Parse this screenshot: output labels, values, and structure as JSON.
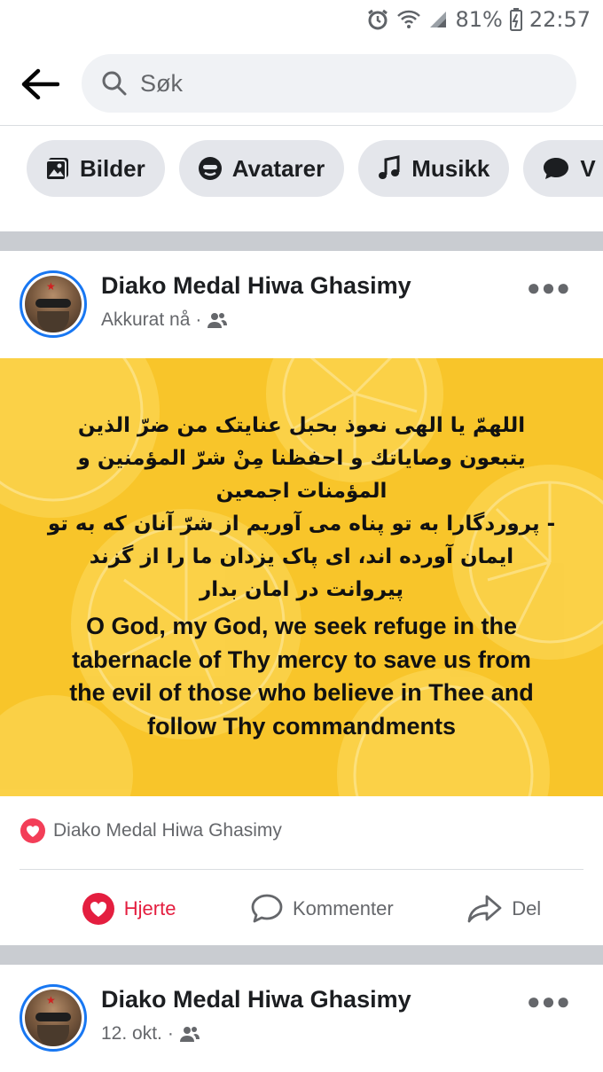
{
  "status_bar": {
    "battery": "81%",
    "time": "22:57"
  },
  "search": {
    "placeholder": "Søk",
    "value": ""
  },
  "chips": [
    {
      "label": "Bilder",
      "icon": "image-icon"
    },
    {
      "label": "Avatarer",
      "icon": "avatar-icon"
    },
    {
      "label": "Musikk",
      "icon": "music-note-icon"
    },
    {
      "label": "V",
      "icon": "chat-bubble-icon"
    }
  ],
  "posts": [
    {
      "author": "Diako Medal Hiwa Ghasimy",
      "time": "Akkurat nå",
      "audience_icon": "friends-icon",
      "text": {
        "arabic_lines": [
          "اللهمّ يا الهی نعوذ بحبل عنايتک من ضرّ الذين",
          "يتبعون وصاياتك و احفظنا مِنْ شرّ المؤمنين و",
          "المؤمنات اجمعين"
        ],
        "persian_lines": [
          "- پروردگارا به تو پناه می آوریم از شرّ آنان که به تو",
          "ایمان آورده اند، ای پاک یزدان ما را از گزند",
          "پیروانت در امان بدار"
        ],
        "english_lines": [
          "O God, my God, we seek refuge in the",
          "tabernacle of Thy mercy to save us from",
          "the evil of those who believe in Thee and",
          "follow Thy commandments"
        ]
      },
      "reaction_by": "Diako Medal Hiwa Ghasimy",
      "actions": {
        "like": "Hjerte",
        "comment": "Kommenter",
        "share": "Del"
      }
    },
    {
      "author": "Diako Medal Hiwa Ghasimy",
      "time": "12. okt.",
      "audience_icon": "friends-icon"
    }
  ],
  "colors": {
    "accent": "#1877f2",
    "heart": "#e41e3f",
    "image_bg": "#f8c52a"
  }
}
